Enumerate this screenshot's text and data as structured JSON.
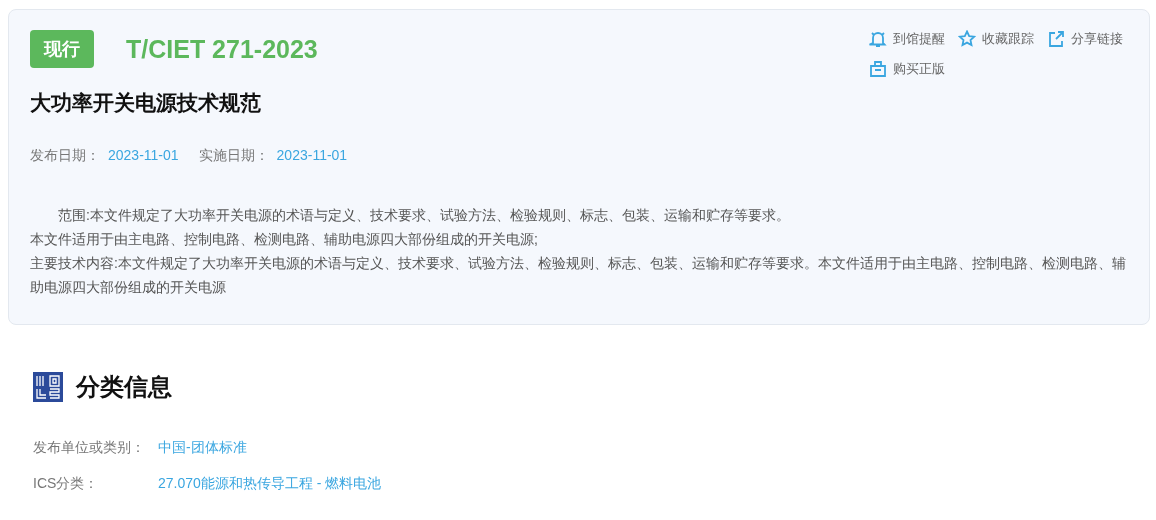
{
  "status_badge": "现行",
  "code": "T/CIET 271-2023",
  "title": "大功率开关电源技术规范",
  "actions": [
    {
      "kind": "bell",
      "label": "到馆提醒"
    },
    {
      "kind": "star",
      "label": "收藏跟踪"
    },
    {
      "kind": "share",
      "label": "分享链接"
    },
    {
      "kind": "bag",
      "label": "购买正版"
    }
  ],
  "dates": [
    {
      "label": "发布日期：",
      "value": "2023-11-01"
    },
    {
      "label": "实施日期：",
      "value": "2023-11-01"
    }
  ],
  "description": [
    "范围:本文件规定了大功率开关电源的术语与定义、技术要求、试验方法、检验规则、标志、包装、运输和贮存等要求。",
    "本文件适用于由主电路、控制电路、检测电路、辅助电源四大部份组成的开关电源;",
    "主要技术内容:本文件规定了大功率开关电源的术语与定义、技术要求、试验方法、检验规则、标志、包装、运输和贮存等要求。本文件适用于由主电路、控制电路、检测电路、辅助电源四大部份组成的开关电源"
  ],
  "section": {
    "title": "分类信息",
    "rows": [
      {
        "label": "发布单位或类别：",
        "value": "中国-团体标准"
      },
      {
        "label": "ICS分类：",
        "value": "27.070能源和热传导工程 - 燃料电池"
      }
    ]
  }
}
